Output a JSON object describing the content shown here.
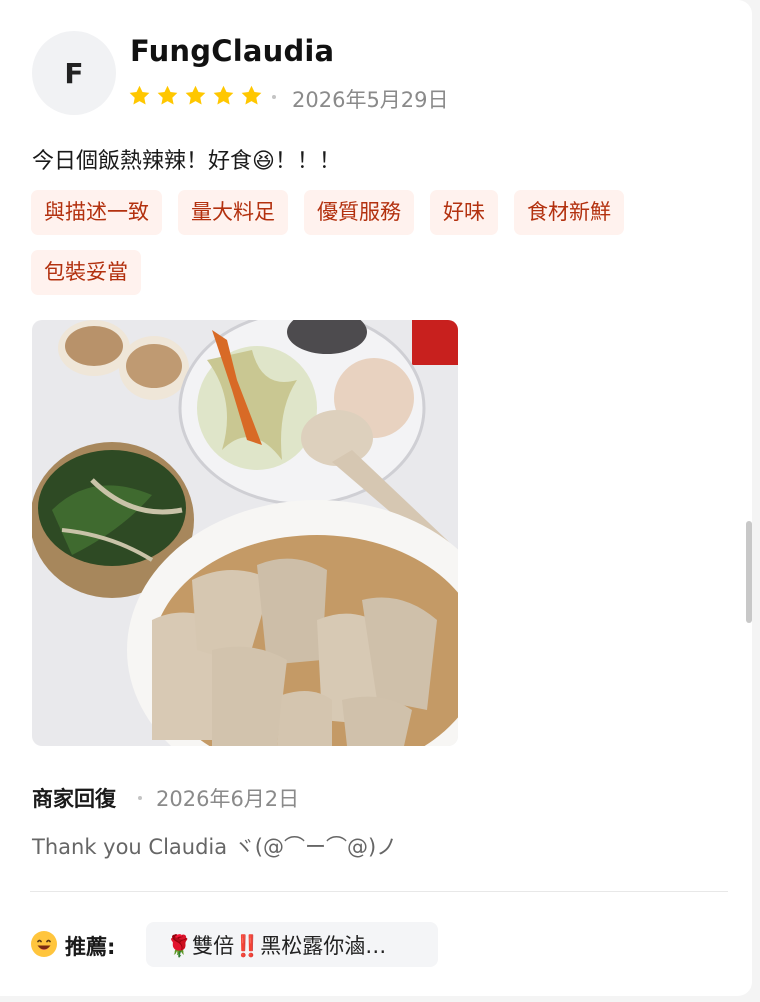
{
  "review": {
    "avatar_initial": "F",
    "username": "FungClaudia",
    "rating": 5,
    "date": "2026年5月29日",
    "comment": "今日個飯熱辣辣！好食😆！！！",
    "tags": [
      "與描述一致",
      "量大料足",
      "優質服務",
      "好味",
      "食材新鮮",
      "包裝妥當"
    ]
  },
  "merchant_reply": {
    "title": "商家回復",
    "date": "2026年6月2日",
    "text": "Thank you Claudia ヾ(@⌒ー⌒@)ノ"
  },
  "recommendation": {
    "label": "推薦:",
    "item": "🌹雙倍‼️黑松露你滷…"
  },
  "colors": {
    "star": "#ffc700",
    "tag_bg": "#fff2ee",
    "tag_text": "#b3310f"
  }
}
